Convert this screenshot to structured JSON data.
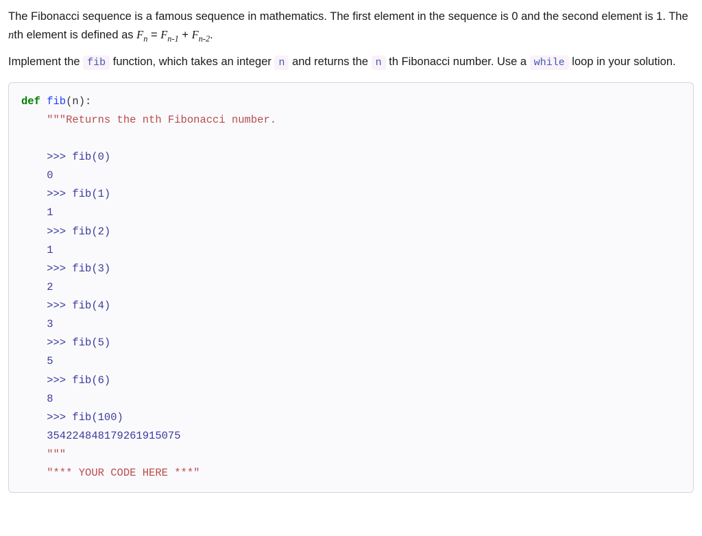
{
  "intro": {
    "p1_part1": "The Fibonacci sequence is a famous sequence in mathematics. The first element in the sequence is 0 and the second element is 1. The ",
    "nth": "n",
    "p1_part2": "th element is defined as ",
    "formula_lhs_F": "F",
    "formula_lhs_sub": "n",
    "formula_eq": " = ",
    "formula_r1_F": "F",
    "formula_r1_sub": "n-1",
    "formula_plus": " + ",
    "formula_r2_F": "F",
    "formula_r2_sub": "n-2",
    "formula_end": "."
  },
  "task": {
    "part1": "Implement the ",
    "fib_code": "fib",
    "part2": " function, which takes an integer ",
    "n_code": "n",
    "part3": " and returns the ",
    "n_code2": "n",
    "part4": " th Fibonacci number. Use a ",
    "while_code": "while",
    "part5": " loop in your solution."
  },
  "code": {
    "def_kw": "def",
    "fn_name": " fib",
    "params": "(n):",
    "doc_open": "    \"\"\"Returns the nth Fibonacci number.",
    "examples": [
      {
        "call": "    >>> fib(0)",
        "result": "    0"
      },
      {
        "call": "    >>> fib(1)",
        "result": "    1"
      },
      {
        "call": "    >>> fib(2)",
        "result": "    1"
      },
      {
        "call": "    >>> fib(3)",
        "result": "    2"
      },
      {
        "call": "    >>> fib(4)",
        "result": "    3"
      },
      {
        "call": "    >>> fib(5)",
        "result": "    5"
      },
      {
        "call": "    >>> fib(6)",
        "result": "    8"
      },
      {
        "call": "    >>> fib(100)",
        "result": "    354224848179261915075"
      }
    ],
    "doc_close": "    \"\"\"",
    "placeholder": "    \"*** YOUR CODE HERE ***\""
  }
}
